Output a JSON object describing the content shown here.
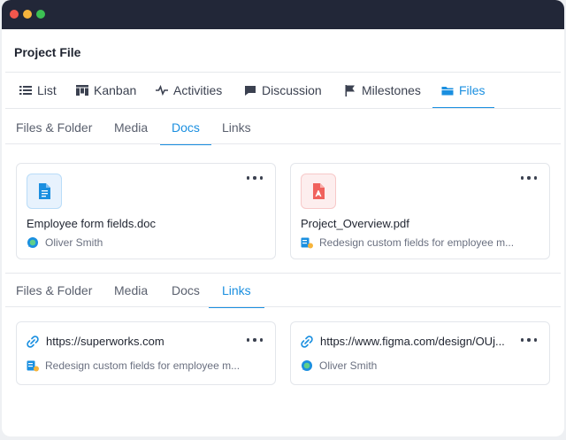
{
  "page": {
    "title": "Project File"
  },
  "main_tabs": [
    {
      "label": "List",
      "icon": "list-icon"
    },
    {
      "label": "Kanban",
      "icon": "kanban-icon"
    },
    {
      "label": "Activities",
      "icon": "activity-icon"
    },
    {
      "label": "Discussion",
      "icon": "chat-icon"
    },
    {
      "label": "Milestones",
      "icon": "flag-icon"
    },
    {
      "label": "Files",
      "icon": "folder-icon",
      "active": true
    }
  ],
  "docs_section": {
    "tabs": [
      {
        "label": "Files & Folder"
      },
      {
        "label": "Media"
      },
      {
        "label": "Docs",
        "active": true
      },
      {
        "label": "Links"
      }
    ],
    "cards": [
      {
        "name": "Employee form fields.doc",
        "type_icon": "doc-file-icon",
        "meta": "Oliver Smith",
        "meta_icon": "chat-bubble-icon"
      },
      {
        "name": "Project_Overview.pdf",
        "type_icon": "pdf-file-icon",
        "meta": "Redesign custom fields for employee m...",
        "meta_icon": "task-icon"
      }
    ]
  },
  "links_section": {
    "tabs": [
      {
        "label": "Files & Folder"
      },
      {
        "label": "Media"
      },
      {
        "label": "Docs"
      },
      {
        "label": "Links",
        "active": true
      }
    ],
    "cards": [
      {
        "url": "https://superworks.com",
        "meta": "Redesign custom fields for employee m...",
        "meta_icon": "task-icon"
      },
      {
        "url": "https://www.figma.com/design/OUj...",
        "meta": "Oliver Smith",
        "meta_icon": "chat-bubble-icon"
      }
    ]
  },
  "colors": {
    "accent": "#1a8fe0",
    "titlebar": "#222738",
    "pdf": "#f0625d",
    "doc": "#1a8fe0"
  }
}
